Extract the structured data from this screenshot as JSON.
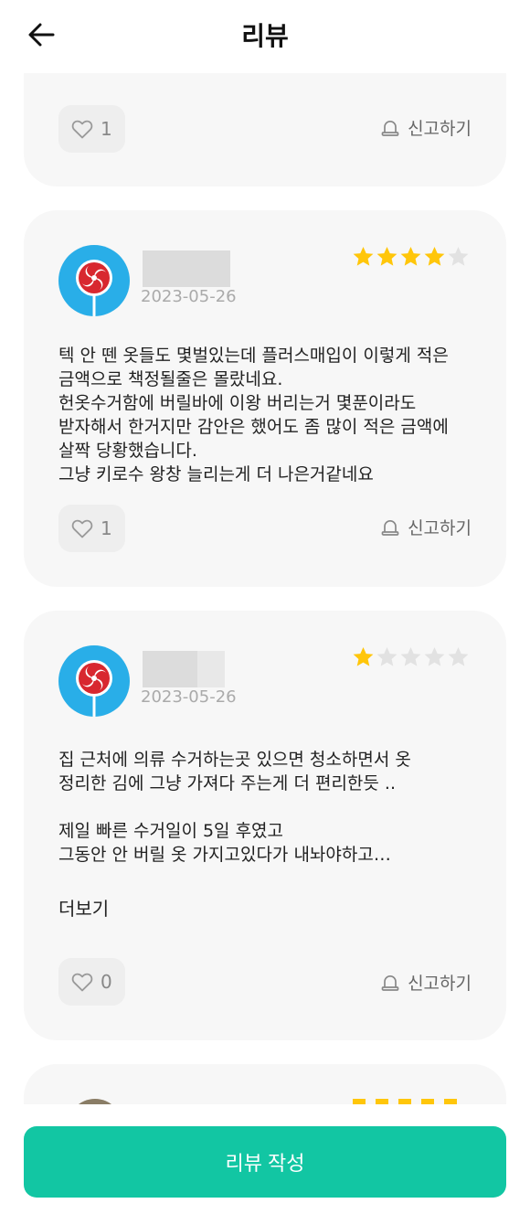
{
  "header": {
    "title": "리뷰"
  },
  "reviews": [
    {
      "likes": "1",
      "report_label": "신고하기"
    },
    {
      "date": "2023-05-26",
      "rating": 4,
      "text": "텍 안 뗀 옷들도 몇벌있는데 플러스매입이 이렇게 적은\n금액으로 책정될줄은 몰랐네요.\n헌옷수거함에 버릴바에 이왕 버리는거 몇푼이라도\n받자해서 한거지만 감안은 했어도 좀 많이 적은 금액에\n살짝 당황했습니다.\n그냥 키로수 왕창 늘리는게 더 나은거같네요",
      "likes": "1",
      "report_label": "신고하기"
    },
    {
      "date": "2023-05-26",
      "rating": 1,
      "text": "집 근처에 의류 수거하는곳 있으면 청소하면서 옷\n정리한 김에 그냥 가져다 주는게 더 편리한듯 ..\n\n제일 빠른 수거일이 5일 후였고\n그동안 안 버릴 옷 가지고있다가 내놔야하고…",
      "more_label": "더보기",
      "likes": "0",
      "report_label": "신고하기"
    }
  ],
  "write_button": {
    "label": "리뷰 작성"
  },
  "colors": {
    "accent": "#12c6a3",
    "star_on": "#ffc60a",
    "star_off": "#e2e2e2",
    "avatar_bg": "#29aee8"
  },
  "icons": {
    "back": "arrow-left-icon",
    "like": "heart-outline-icon",
    "report": "siren-icon",
    "star": "star-icon",
    "avatar": "lollipop-icon"
  }
}
